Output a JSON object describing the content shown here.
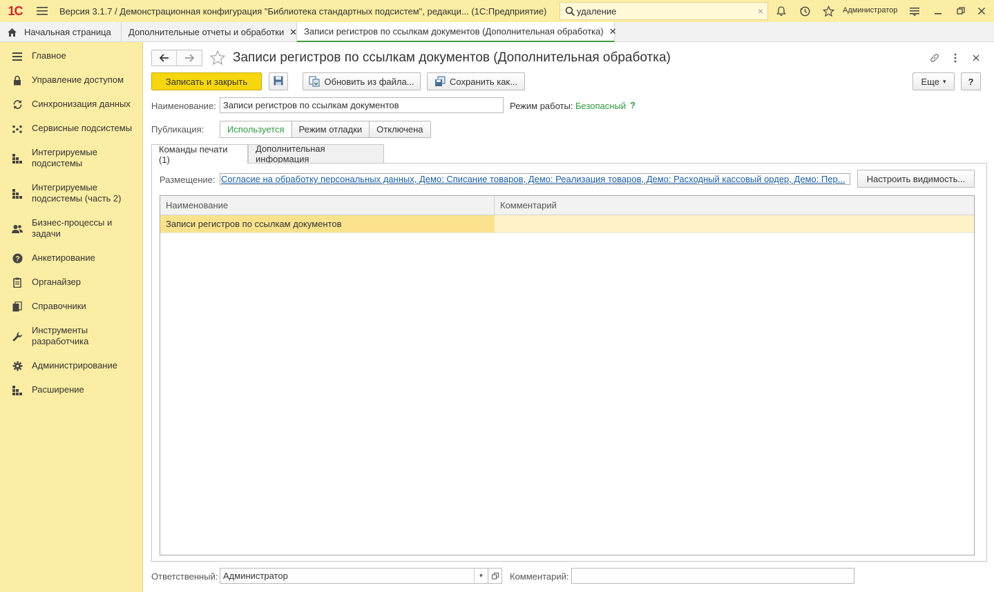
{
  "titlebar": {
    "logo": "1С",
    "title": "Версия 3.1.7 / Демонстрационная конфигурация \"Библиотека стандартных подсистем\", редакци...  (1С:Предприятие)",
    "search_value": "удаление",
    "clear": "×",
    "user": "Администратор"
  },
  "tabs": [
    {
      "label": "Начальная страница"
    },
    {
      "label": "Дополнительные отчеты и обработки",
      "close": "✕"
    },
    {
      "label": "Записи регистров по ссылкам документов (Дополнительная обработка)",
      "close": "✕"
    }
  ],
  "sidebar": {
    "items": [
      {
        "label": "Главное",
        "icon": "menu-lines-icon"
      },
      {
        "label": "Управление доступом",
        "icon": "lock-icon"
      },
      {
        "label": "Синхронизация данных",
        "icon": "sync-icon"
      },
      {
        "label": "Сервисные подсистемы",
        "icon": "dots-grid-icon"
      },
      {
        "label": "Интегрируемые подсистемы",
        "icon": "blocks-icon"
      },
      {
        "label": "Интегрируемые подсистемы (часть 2)",
        "icon": "blocks-icon"
      },
      {
        "label": "Бизнес-процессы и задачи",
        "icon": "people-icon"
      },
      {
        "label": "Анкетирование",
        "icon": "question-icon"
      },
      {
        "label": "Органайзер",
        "icon": "clipboard-icon"
      },
      {
        "label": "Справочники",
        "icon": "books-icon"
      },
      {
        "label": "Инструменты разработчика",
        "icon": "wrench-icon"
      },
      {
        "label": "Администрирование",
        "icon": "gear-icon"
      },
      {
        "label": "Расширение",
        "icon": "blocks-icon"
      }
    ]
  },
  "form": {
    "title": "Записи регистров по ссылкам документов (Дополнительная обработка)",
    "buttons": {
      "save_close": "Записать и закрыть",
      "update_from_file": "Обновить из файла...",
      "save_as": "Сохранить как...",
      "more": "Еще",
      "more_arrow": "▾",
      "help": "?"
    },
    "name_label": "Наименование:",
    "name_value": "Записи регистров по ссылкам документов",
    "mode_label": "Режим работы:",
    "mode_value": "Безопасный",
    "mode_help": "?",
    "publication_label": "Публикация:",
    "publication_options": [
      "Используется",
      "Режим отладки",
      "Отключена"
    ],
    "tabs": [
      "Команды печати (1)",
      "Дополнительная информация"
    ],
    "placement_label": "Размещение:",
    "placement_link": "Согласие на обработку персональных данных, Демо: Списание товаров, Демо: Реализация товаров, Демо: Расходный кассовый ордер, Демо: Пер...",
    "visibility_button": "Настроить видимость...",
    "grid": {
      "columns": [
        "Наименование",
        "Комментарий"
      ],
      "rows": [
        {
          "name": "Записи регистров по ссылкам документов",
          "comment": ""
        }
      ]
    },
    "responsible_label": "Ответственный:",
    "responsible_value": "Администратор",
    "comment_label": "Комментарий:",
    "comment_value": ""
  },
  "colors": {
    "accent_yellow": "#fbeda3",
    "primary_button": "#f6d70f",
    "active_tab_underline": "#3d9a3d",
    "green_text": "#2f9a3e",
    "link": "#1b5ea6"
  }
}
